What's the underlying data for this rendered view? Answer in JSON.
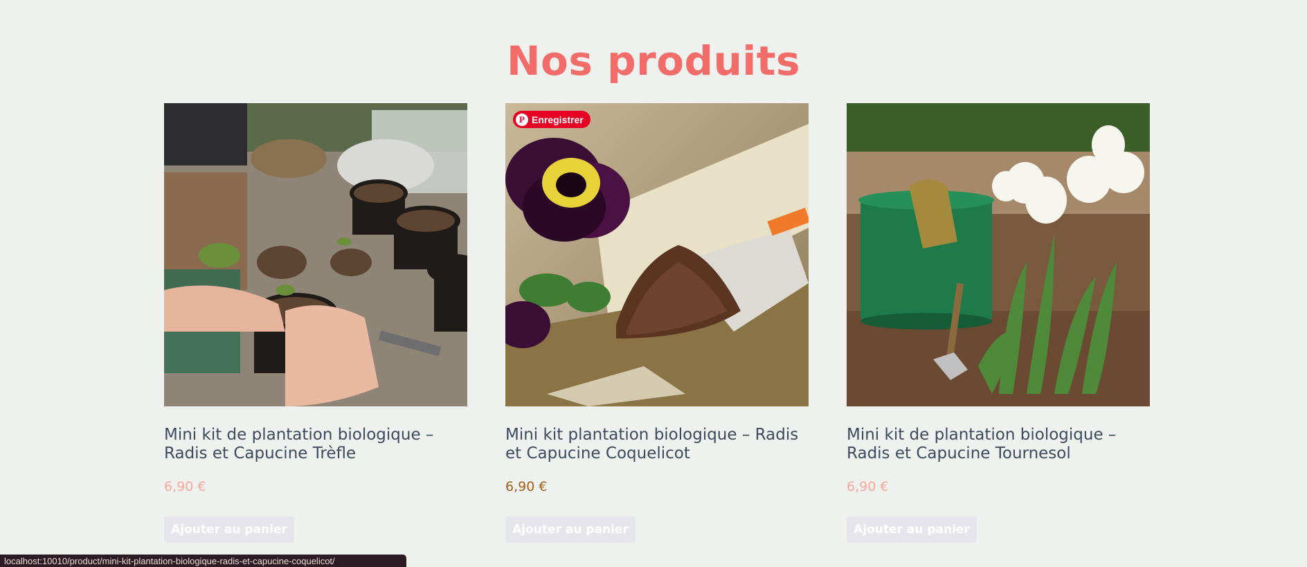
{
  "section": {
    "title": "Nos produits"
  },
  "products": [
    {
      "title": "Mini kit de plantation biologique – Radis et Capucine Trèfle",
      "price": "6,90 €",
      "button": "Ajouter au panier",
      "image_icon": "seedling-repotting-photo"
    },
    {
      "title": "Mini kit plantation biologique – Radis et Capucine Coquelicot",
      "price": "6,90 €",
      "button": "Ajouter au panier",
      "image_icon": "pansy-soil-trowel-photo",
      "pin_label": "Enregistrer"
    },
    {
      "title": "Mini kit de plantation biologique – Radis et Capucine Tournesol",
      "price": "6,90 €",
      "button": "Ajouter au panier",
      "image_icon": "tulips-bucket-photo"
    }
  ],
  "status_bar": {
    "url": "localhost:10010/product/mini-kit-plantation-biologique-radis-et-capucine-coquelicot/"
  },
  "colors": {
    "background": "#eef1ee",
    "title": "#f26d6a",
    "price": "#f5a99c",
    "price_hover": "#a0621a",
    "button_bg": "#e7e5ec",
    "pin": "#e60023"
  }
}
